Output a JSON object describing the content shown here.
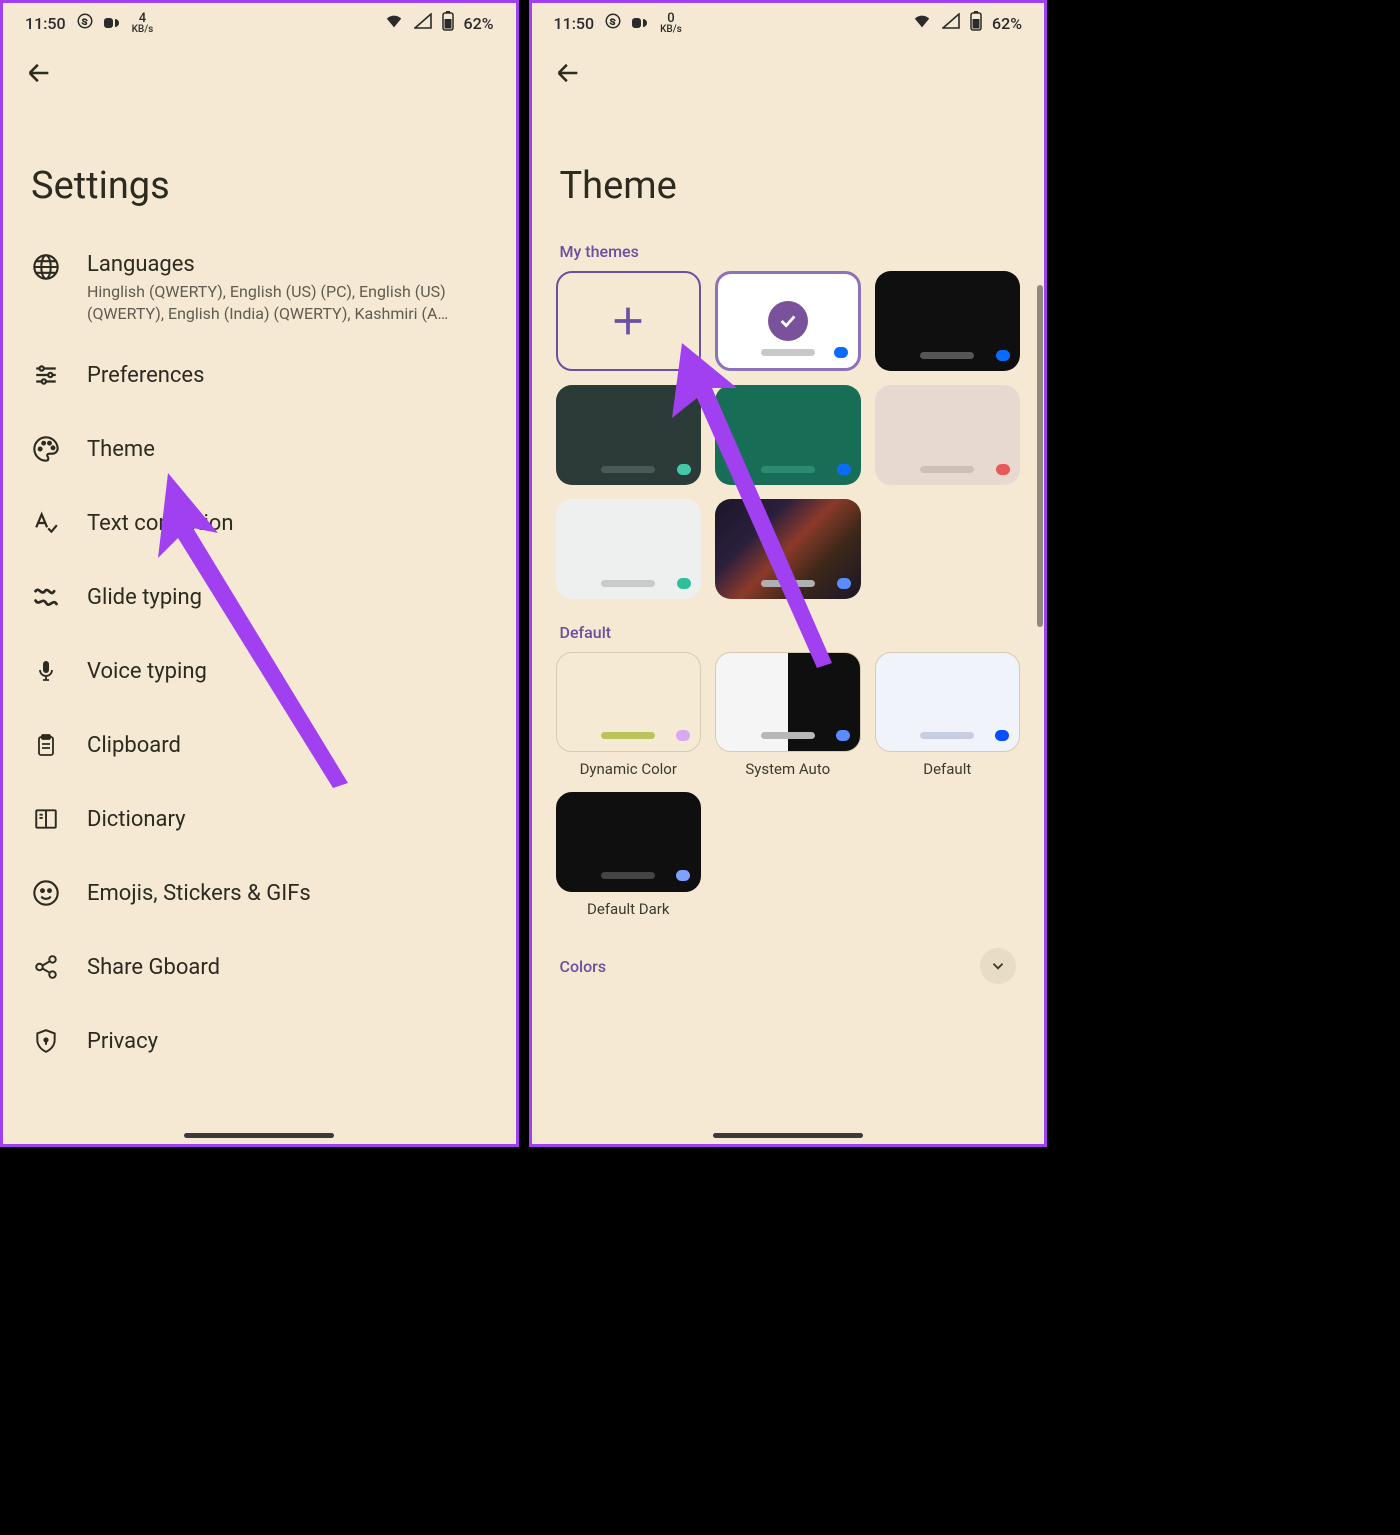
{
  "status": {
    "time": "11:50",
    "kbs_left": "4",
    "kbs_right": "0",
    "kbs_label": "KB/s",
    "battery": "62%"
  },
  "settings": {
    "title": "Settings",
    "items": [
      {
        "label": "Languages",
        "sub": "Hinglish (QWERTY), English (US) (PC), English (US) (QWERTY), English (India) (QWERTY), Kashmiri (A…"
      },
      {
        "label": "Preferences"
      },
      {
        "label": "Theme"
      },
      {
        "label": "Text correction"
      },
      {
        "label": "Glide typing"
      },
      {
        "label": "Voice typing"
      },
      {
        "label": "Clipboard"
      },
      {
        "label": "Dictionary"
      },
      {
        "label": "Emojis, Stickers & GIFs"
      },
      {
        "label": "Share Gboard"
      },
      {
        "label": "Privacy"
      }
    ]
  },
  "theme": {
    "title": "Theme",
    "my_themes_label": "My themes",
    "default_label": "Default",
    "colors_label": "Colors",
    "my_themes": [
      {
        "type": "add"
      },
      {
        "type": "selected",
        "bg": "#ffffff",
        "dot": "#0a6cff"
      },
      {
        "bg": "#0f0f0f",
        "dot": "#0a6cff",
        "bar": "#555"
      },
      {
        "bg": "#2c3a38",
        "dot": "#46c9a8",
        "bar": "#4a5a58"
      },
      {
        "bg": "#176d56",
        "dot": "#0a6cff",
        "bar": "#2d8a72"
      },
      {
        "bg": "#e8d9d0",
        "dot": "#e85a5a",
        "bar": "#cfc0b7"
      },
      {
        "bg": "#eef0ef",
        "dot": "#2fc09a",
        "bar": "#c8cbca"
      },
      {
        "bg": "image",
        "dot": "#5b8cff",
        "bar": "#b0b0b0"
      }
    ],
    "defaults": [
      {
        "label": "Dynamic Color",
        "bg": "#f5ebd4",
        "bar": "#bcc35d",
        "dot": "#d9a8f0"
      },
      {
        "label": "System Auto",
        "split": true,
        "bar": "#b7b7b7",
        "dot": "#5b8cff"
      },
      {
        "label": "Default",
        "bg": "#f1f3fa",
        "bar": "#c8cde0",
        "dot": "#0a4cff"
      },
      {
        "label": "Default Dark",
        "bg": "#0f0f0f",
        "bar": "#444",
        "dot": "#7ea0ff"
      }
    ]
  }
}
